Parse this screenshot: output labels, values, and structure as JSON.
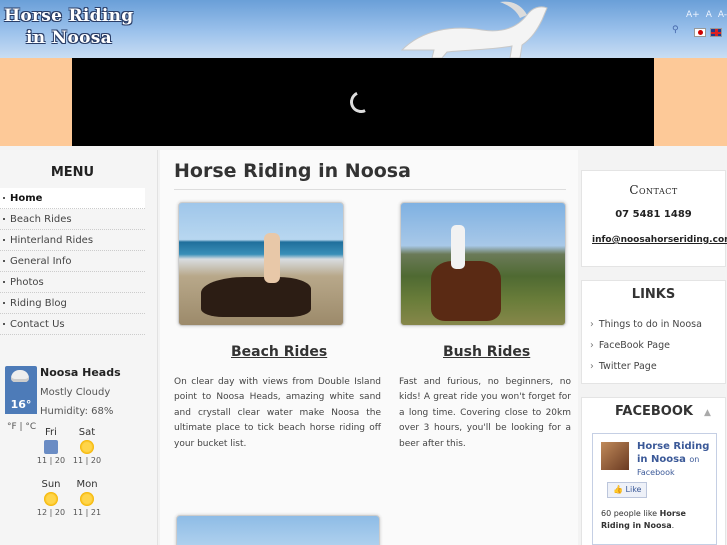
{
  "header": {
    "logo_line1": "Horse Riding",
    "logo_line2": "in Noosa",
    "font_tools": [
      "A+",
      "A",
      "A-"
    ],
    "languages": [
      "Japanese",
      "English"
    ]
  },
  "menu": {
    "title": "MENU",
    "items": [
      {
        "label": "Home",
        "active": true
      },
      {
        "label": "Beach Rides"
      },
      {
        "label": "Hinterland Rides"
      },
      {
        "label": "General Info"
      },
      {
        "label": "Photos"
      },
      {
        "label": "Riding Blog"
      },
      {
        "label": "Contact Us"
      }
    ]
  },
  "weather": {
    "location": "Noosa Heads",
    "temp": "16°",
    "condition": "Mostly Cloudy",
    "humidity": "Humidity: 68%",
    "units": "°F | °C",
    "forecast": [
      {
        "day": "Fri",
        "range": "11 | 20",
        "icon": "storm-icon"
      },
      {
        "day": "Sat",
        "range": "11 | 20",
        "icon": "sun-icon"
      },
      {
        "day": "Sun",
        "range": "12 | 20",
        "icon": "sun-icon"
      },
      {
        "day": "Mon",
        "range": "11 | 21",
        "icon": "sun-icon"
      }
    ]
  },
  "main": {
    "title": "Horse Riding in Noosa",
    "sections": [
      {
        "title": "Beach Rides",
        "body": "On clear day with views from Double Island point to Noosa Heads, amazing white sand and crystall clear water make Noosa the ultimate place to tick beach horse riding off your bucket list."
      },
      {
        "title": "Bush Rides",
        "body": "Fast and furious, no beginners, no kids! A great ride you won't forget for a long time. Covering close to 20km over 3 hours, you'll be looking for a beer after this."
      }
    ]
  },
  "contact": {
    "title": "Contact",
    "phone": "07 5481 1489",
    "email": "info@noosahorseriding.com"
  },
  "links": {
    "title": "LINKS",
    "items": [
      "Things to do in Noosa",
      "FaceBook Page",
      "Twitter Page"
    ]
  },
  "facebook": {
    "title": "FACEBOOK",
    "page_name": "Horse Riding in Noosa",
    "on_text": "on",
    "platform": "Facebook",
    "like_label": "Like",
    "likes_prefix": "60 people like",
    "likes_page": "Horse Riding in Noosa",
    "likes_suffix": "."
  },
  "colors": {
    "header_blue": "#6a9fd8",
    "slide_band": "#fdc998",
    "fb_blue": "#3b5998"
  }
}
